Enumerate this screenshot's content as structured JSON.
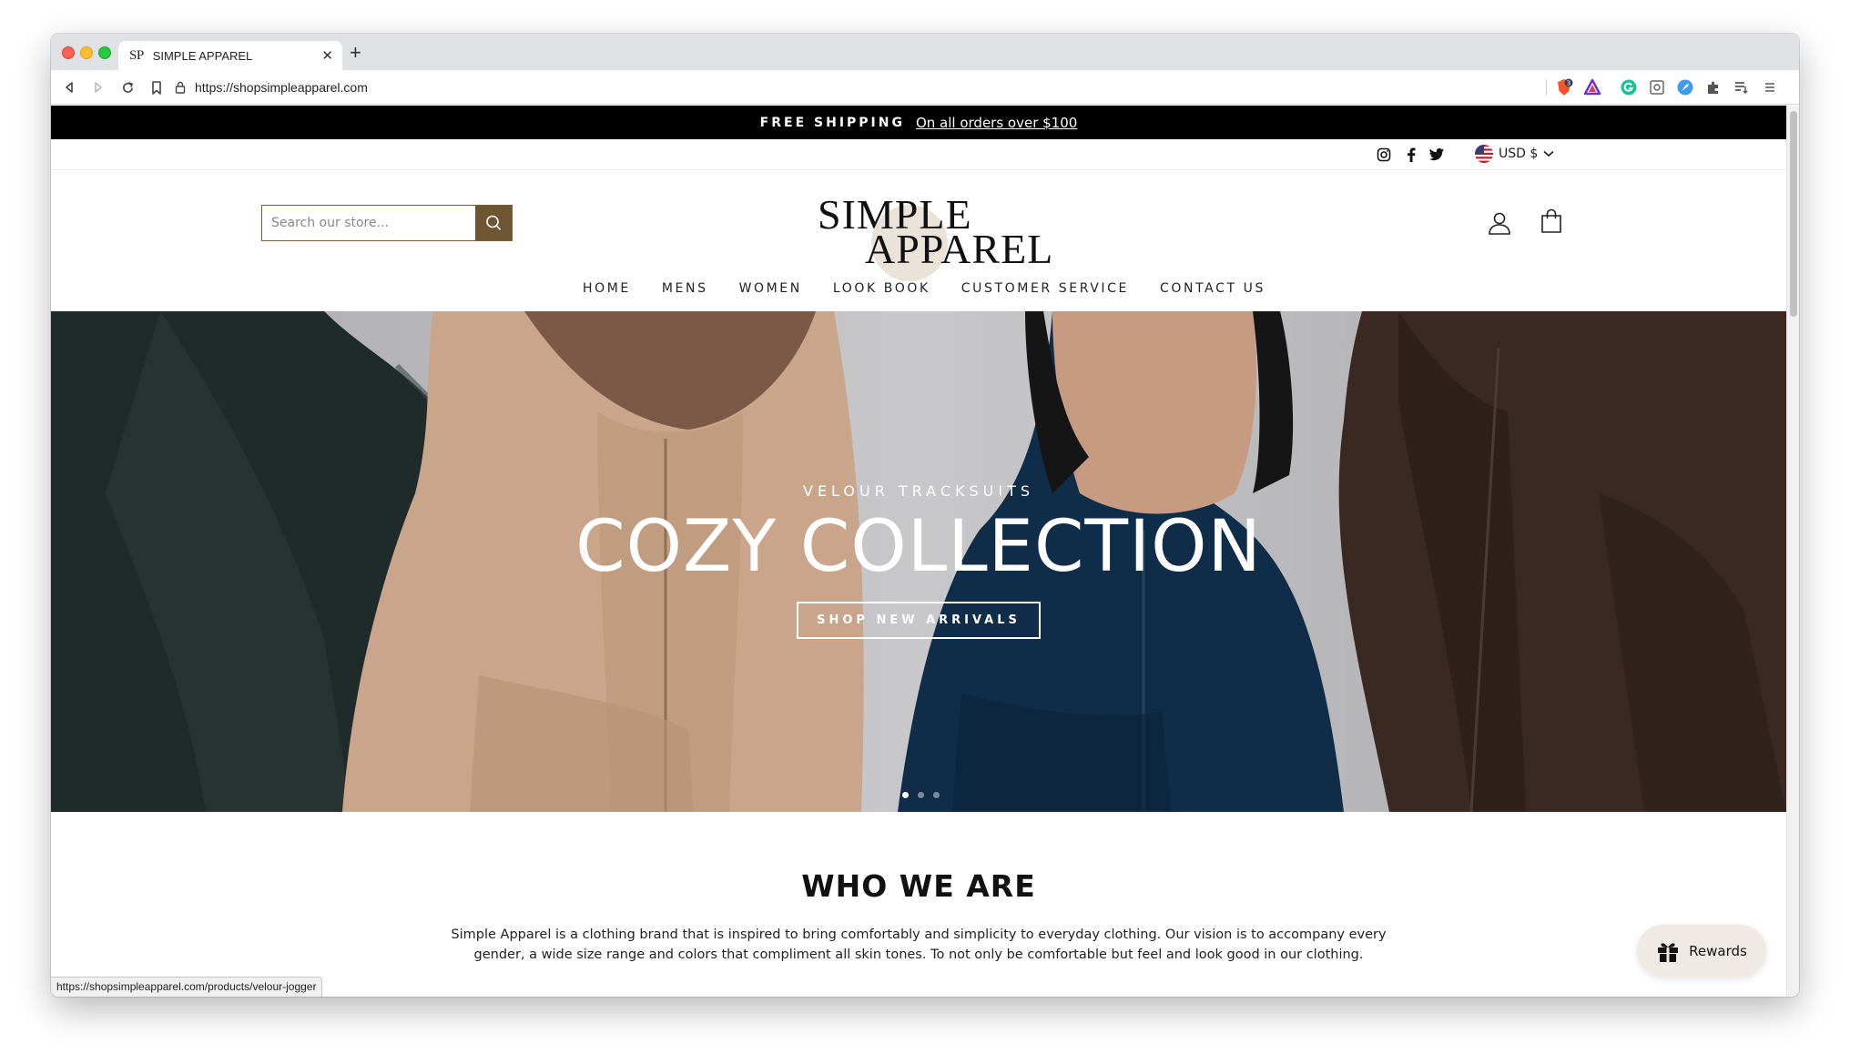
{
  "browser": {
    "tab_title": "SIMPLE APPAREL",
    "tab_favicon": "SP",
    "url": "https://shopsimpleapparel.com",
    "status_url": "https://shopsimpleapparel.com/products/velour-jogger",
    "extension_badge": "3"
  },
  "announcement": {
    "strong": "FREE SHIPPING",
    "link": "On all orders over $100"
  },
  "utility": {
    "social_icons": [
      "instagram-icon",
      "facebook-icon",
      "twitter-icon"
    ],
    "currency": "USD $"
  },
  "header": {
    "search_placeholder": "Search our store...",
    "logo_line1": "SIMPLE",
    "logo_line2": "APPAREL"
  },
  "nav": {
    "items": [
      "HOME",
      "MENS",
      "WOMEN",
      "LOOK BOOK",
      "CUSTOMER SERVICE",
      "CONTACT US"
    ]
  },
  "hero": {
    "eyebrow": "VELOUR TRACKSUITS",
    "title": "COZY COLLECTION",
    "cta": "SHOP NEW ARRIVALS",
    "slide_count": 3,
    "active_slide": 1
  },
  "who": {
    "title": "WHO WE ARE",
    "body": "Simple Apparel is a clothing brand that is inspired to bring comfortably and simplicity to everyday clothing. Our vision is to accompany every gender, a wide size range and colors that compliment all skin tones. To not only be comfortable but feel and look good in our clothing."
  },
  "rewards": {
    "label": "Rewards"
  },
  "colors": {
    "announcement_bg": "#000000",
    "search_button": "#6e5633",
    "logo_circle": "#e9e3da",
    "rewards_bg": "#efebe4"
  }
}
